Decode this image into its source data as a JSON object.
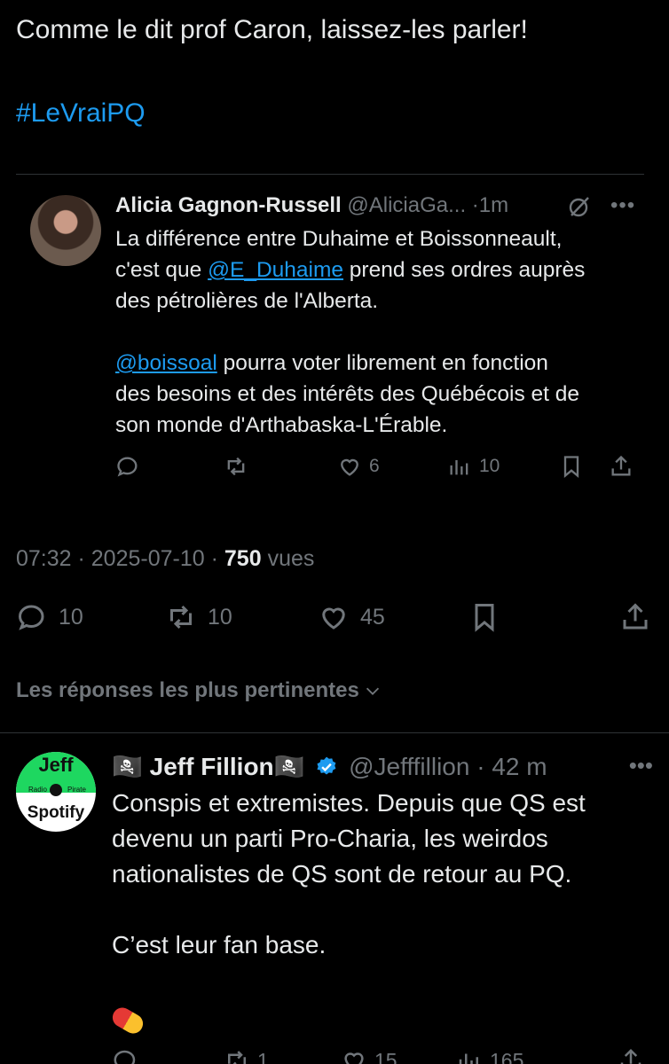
{
  "main_tweet": {
    "text_line1": "Comme le dit prof Caron, laissez-les parler!",
    "hashtag": "#LeVraiPQ"
  },
  "quoted_tweet": {
    "name": "Alicia Gagnon-Russell",
    "handle": "@AliciaGa...",
    "time": "1m",
    "avatar_icon": "profile-photo",
    "body": {
      "line1": "La différence entre Duhaime et Boissonneault,",
      "line2_pre": "c'est que ",
      "line2_mention": "@E_Duhaime",
      "line2_post": " prend ses ordres auprès",
      "line3": "des pétrolières de l'Alberta.",
      "line4_mention": "@boissoal",
      "line4_post": " pourra voter librement en fonction",
      "line5": "des besoins et des intérêts des Québécois et de",
      "line6": "son monde d'Arthabaska-L'Érable."
    },
    "likes": "6",
    "views": "10"
  },
  "meta": {
    "time": "07:32",
    "date": "2025-07-10",
    "views_count": "750",
    "views_label": "vues",
    "sep": " · "
  },
  "main_actions": {
    "replies": "10",
    "reposts": "10",
    "likes": "45"
  },
  "sort_label": "Les réponses les plus pertinentes",
  "reply": {
    "flag": "🏴‍☠️",
    "name": "Jeff Fillion",
    "handle": "@Jefffillion",
    "time": "42 m",
    "avatar": {
      "top": "Jeff",
      "radio": "Radio",
      "pirate": "Pirate",
      "bottom": "Spotify"
    },
    "body": {
      "line1": "Conspis et extremistes. Depuis que QS est",
      "line2": "devenu un parti Pro-Charia, les weirdos",
      "line3": "nationalistes de QS sont de retour au PQ.",
      "line4": "C’est leur fan base."
    },
    "reposts": "1",
    "likes": "15",
    "views": "165"
  },
  "colors": {
    "background": "#000000",
    "text": "#e7e9ea",
    "muted": "#71767b",
    "accent": "#1d9bf0",
    "divider": "#2f3336"
  }
}
